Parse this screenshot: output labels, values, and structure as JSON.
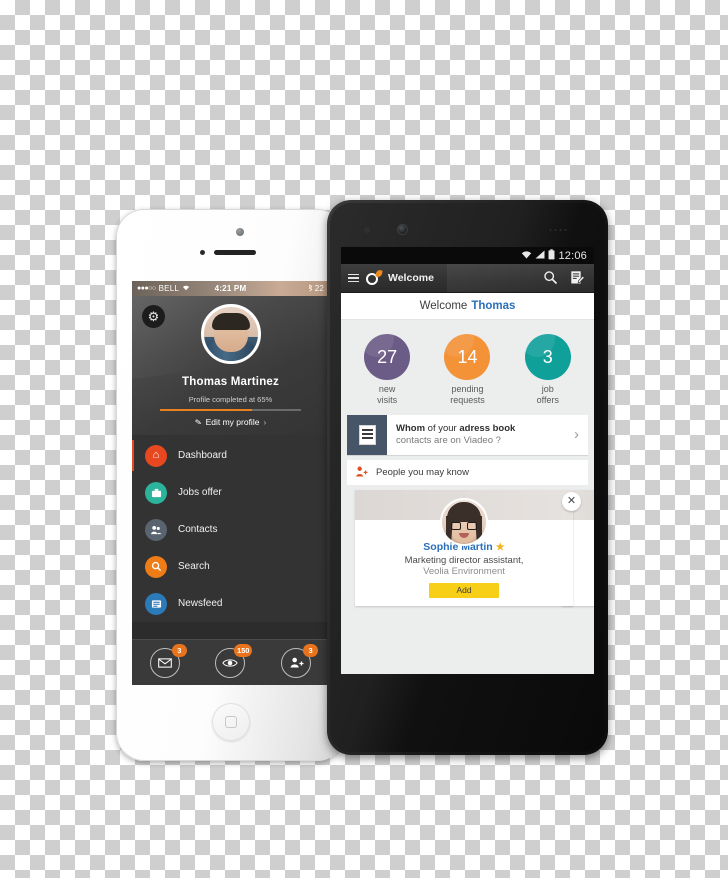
{
  "iphone": {
    "status": {
      "signal_dots": "●●●○○",
      "carrier": "BELL",
      "wifi_icon": "wifi-icon",
      "time": "4:21 PM",
      "bluetooth_icon": "bluetooth-icon",
      "battery": "22"
    },
    "header": {
      "settings_icon": "gear-icon",
      "avatar": "user-avatar",
      "name": "Thomas Martinez",
      "progress_label": "Profile completed at 65%",
      "progress_percent": 65,
      "edit_label": "Edit my profile",
      "edit_pen_icon": "pencil-icon",
      "edit_chevron": "›",
      "accent_color": "#e8821e"
    },
    "menu": [
      {
        "label": "Dashboard",
        "icon": "home-icon",
        "glyph": "⌂",
        "color": "#e8481f",
        "active": true
      },
      {
        "label": "Jobs offer",
        "icon": "briefcase-icon",
        "glyph": "▬",
        "color": "#2bb39c",
        "active": false
      },
      {
        "label": "Contacts",
        "icon": "contacts-icon",
        "glyph": "♟",
        "color": "#5a6470",
        "active": false
      },
      {
        "label": "Search",
        "icon": "search-icon",
        "glyph": "⌕",
        "color": "#ef7c14",
        "active": false
      },
      {
        "label": "Newsfeed",
        "icon": "newsfeed-icon",
        "glyph": "▣",
        "color": "#2b7bb9",
        "active": false
      }
    ],
    "tabbar": [
      {
        "icon": "mail-icon",
        "glyph": "✉",
        "badge": "3"
      },
      {
        "icon": "eye-icon",
        "glyph": "◉",
        "badge": "150"
      },
      {
        "icon": "add-contact-icon",
        "glyph": "♟",
        "badge": "3"
      }
    ]
  },
  "android": {
    "status": {
      "wifi_icon": "wifi-icon",
      "signal_icon": "signal-icon",
      "battery_icon": "battery-icon",
      "time": "12:06"
    },
    "actionbar": {
      "menu_icon": "hamburger-menu-icon",
      "logo": "viadeo-logo",
      "title": "Welcome",
      "search_icon": "search-icon",
      "compose_icon": "compose-icon"
    },
    "welcome": {
      "prefix": "Welcome",
      "name": "Thomas"
    },
    "stats": [
      {
        "value": "27",
        "label": "new\nvisits",
        "label_line1": "new",
        "label_line2": "visits",
        "color": "#6b5b87"
      },
      {
        "value": "14",
        "label": "pending\nrequests",
        "label_line1": "pending",
        "label_line2": "requests",
        "color": "#f39237"
      },
      {
        "value": "3",
        "label": "job\noffers",
        "label_line1": "job",
        "label_line2": "offers",
        "color": "#10a09a"
      }
    ],
    "address_book_card": {
      "icon": "address-book-icon",
      "line1_bold_a": "Whom",
      "line1_mid": " of your ",
      "line1_bold_b": "adress book",
      "line2": "contacts are on Viadeo ?",
      "chevron": "›"
    },
    "people_you_may_know": {
      "icon": "add-person-icon",
      "title": "People you may know",
      "person": {
        "avatar": "person-avatar",
        "name": "Sophie Martin",
        "premium_star": "★",
        "role": "Marketing director assistant,",
        "company": "Veolia Environment",
        "add_label": "Add",
        "close_icon": "close-icon",
        "close_glyph": "✕",
        "add_button_color": "#f7cf17"
      }
    }
  }
}
